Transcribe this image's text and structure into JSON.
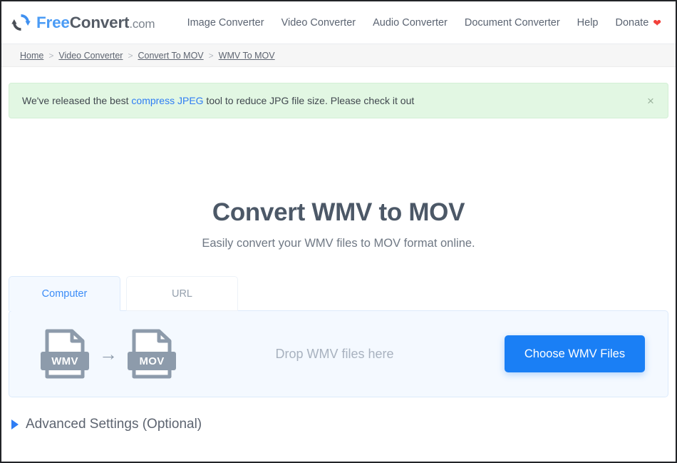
{
  "header": {
    "brand": {
      "icon": "refresh-cycle-icon",
      "part1": "Free",
      "part2": "Convert",
      "part3": ".com"
    },
    "nav": [
      {
        "label": "Image Converter"
      },
      {
        "label": "Video Converter"
      },
      {
        "label": "Audio Converter"
      },
      {
        "label": "Document Converter"
      },
      {
        "label": "Help"
      },
      {
        "label": "Donate",
        "icon": "heart-icon",
        "icon_glyph": "❤",
        "icon_color": "#f2403a"
      }
    ]
  },
  "breadcrumb": {
    "separator": ">",
    "items": [
      {
        "label": "Home"
      },
      {
        "label": "Video Converter"
      },
      {
        "label": "Convert To MOV"
      },
      {
        "label": "WMV To MOV"
      }
    ]
  },
  "alert": {
    "text_before": "We've released the best ",
    "link_text": "compress JPEG",
    "text_after": " tool to reduce JPG file size. Please check it out",
    "close_label": "×",
    "background": "#e2f7e3",
    "link_color": "#2f7df4"
  },
  "hero": {
    "title": "Convert WMV to MOV",
    "subtitle": "Easily convert your WMV files to MOV format online."
  },
  "converter": {
    "tabs": [
      {
        "label": "Computer",
        "active": true
      },
      {
        "label": "URL",
        "active": false
      }
    ],
    "source_format": "WMV",
    "target_format": "MOV",
    "arrow_glyph": "→",
    "drop_text": "Drop WMV files here",
    "choose_button": "Choose WMV Files",
    "accent_color": "#1a7ff5"
  },
  "advanced": {
    "label": "Advanced Settings (Optional)",
    "caret": "caret-right-icon",
    "caret_color": "#2f7df4"
  }
}
